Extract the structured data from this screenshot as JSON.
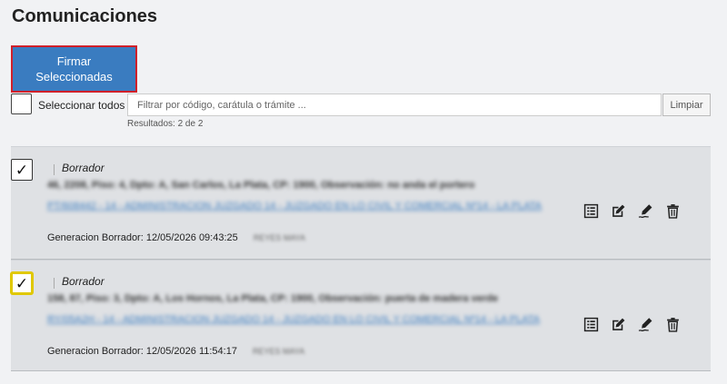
{
  "page": {
    "title": "Comunicaciones"
  },
  "toolbar": {
    "sign_label_line1": "Firmar",
    "sign_label_line2": "Seleccionadas",
    "select_all_label": "Seleccionar todos",
    "filter_placeholder": "Filtrar por código, carátula o trámite ...",
    "clear_label": "Limpiar",
    "results_text": "Resultados: 2 de 2"
  },
  "items": [
    {
      "checked": true,
      "status": "Borrador",
      "address": "46, 2208, Piso: 4, Dpto: A, San Carlos, La Plata, CP: 1900, Observación: no anda el portero",
      "case_link": "PT/608442 - 14 - ADMINISTRACION JUZGADO 14 - JUZGADO EN LO CIVIL Y COMERCIAL Nº14 - LA PLATA",
      "gen_label": "Generacion Borrador: 12/05/2026 09:43:25",
      "gen_user": "REYES MAYA"
    },
    {
      "checked": true,
      "status": "Borrador",
      "address": "158, 87, Piso: 3, Dpto: A, Los Hornos, La Plata, CP: 1900, Observación: puerta de madera verde",
      "case_link": "RY/05A2H - 14 - ADMINISTRACION JUZGADO 14 - JUZGADO EN LO CIVIL Y COMERCIAL Nº14 - LA PLATA",
      "gen_label": "Generacion Borrador: 12/05/2026 11:54:17",
      "gen_user": "REYES MAYA"
    }
  ],
  "icons": {
    "check": "✓",
    "colors": {
      "primary": "#3a7cc0",
      "highlight": "#e0c800",
      "alert": "#d0202a"
    }
  }
}
